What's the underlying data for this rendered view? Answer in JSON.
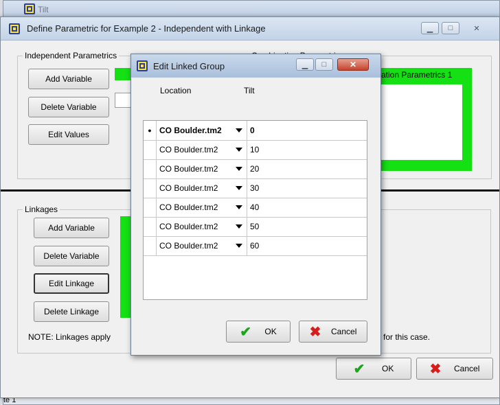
{
  "background_window": {
    "title": "Tilt",
    "status_text": "te 1"
  },
  "main_dialog": {
    "title": "Define Parametric for Example 2 - Independent with Linkage",
    "independent_group": {
      "label": "Independent Parametrics",
      "buttons": [
        "Add Variable",
        "Delete Variable",
        "Edit Values"
      ]
    },
    "combination_group": {
      "label": "Combination Parametrics",
      "panel_text": "ation Parametrics 1"
    },
    "linkages_group": {
      "label": "Linkages",
      "buttons": [
        "Add Variable",
        "Delete Variable",
        "Edit Linkage",
        "Delete Linkage"
      ]
    },
    "note_text": "NOTE: Linkages apply",
    "note_tail": "for this case.",
    "ok_label": "OK",
    "cancel_label": "Cancel"
  },
  "linked_dialog": {
    "title": "Edit Linked Group",
    "columns": [
      "Location",
      "Tilt"
    ],
    "rows": [
      {
        "location": "CO Boulder.tm2",
        "tilt": "0"
      },
      {
        "location": "CO Boulder.tm2",
        "tilt": "10"
      },
      {
        "location": "CO Boulder.tm2",
        "tilt": "20"
      },
      {
        "location": "CO Boulder.tm2",
        "tilt": "30"
      },
      {
        "location": "CO Boulder.tm2",
        "tilt": "40"
      },
      {
        "location": "CO Boulder.tm2",
        "tilt": "50"
      },
      {
        "location": "CO Boulder.tm2",
        "tilt": "60"
      }
    ],
    "ok_label": "OK",
    "cancel_label": "Cancel"
  }
}
